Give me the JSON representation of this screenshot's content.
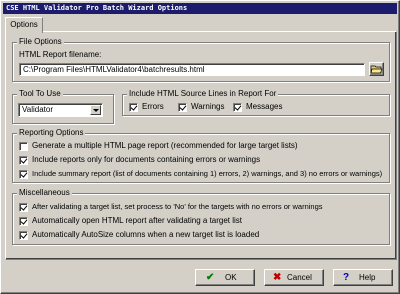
{
  "window": {
    "title": "CSE HTML Validator Pro Batch Wizard Options"
  },
  "tabs": [
    {
      "label": "Options"
    }
  ],
  "file_options": {
    "group_label": "File Options",
    "report_label": "HTML Report filename:",
    "report_value": "C:\\Program Files\\HTMLValidator4\\batchresults.html"
  },
  "tool": {
    "group_label": "Tool To Use",
    "selected": "Validator"
  },
  "source_lines": {
    "group_label": "Include HTML Source Lines in Report For",
    "items": [
      {
        "label": "Errors",
        "checked": true
      },
      {
        "label": "Warnings",
        "checked": true
      },
      {
        "label": "Messages",
        "checked": true
      }
    ]
  },
  "reporting": {
    "group_label": "Reporting Options",
    "items": [
      {
        "label": "Generate a multiple HTML page report (recommended for large target lists)",
        "checked": false
      },
      {
        "label": "Include reports only for documents containing errors or warnings",
        "checked": true
      },
      {
        "label": "Include summary report (list of documents containing 1) errors, 2) warnings, and 3) no errors or warnings)",
        "checked": true
      }
    ]
  },
  "misc": {
    "group_label": "Miscellaneous",
    "items": [
      {
        "label": "After validating a target list, set process to 'No' for the targets with no errors or warnings",
        "checked": true
      },
      {
        "label": "Automatically open HTML report after validating a target list",
        "checked": true
      },
      {
        "label": "Automatically AutoSize columns when a new target list is loaded",
        "checked": true
      }
    ]
  },
  "buttons": {
    "ok": "OK",
    "cancel": "Cancel",
    "help": "Help"
  },
  "colors": {
    "titlebar": "#1c1c6c",
    "face": "#d4d0c8",
    "ok_check": "#008000",
    "cancel_x": "#c00000",
    "help_q": "#0000c0"
  }
}
